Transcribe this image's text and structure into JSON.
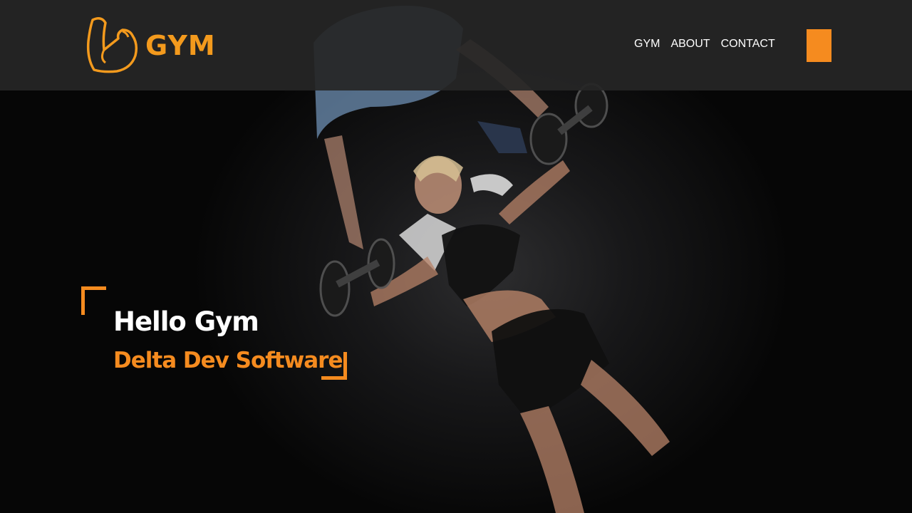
{
  "brand": {
    "logo_text": "GYM",
    "logo_icon": "flexed-arm-icon",
    "accent_color": "#f58b1f"
  },
  "nav": {
    "items": [
      {
        "label": "GYM"
      },
      {
        "label": "ABOUT"
      },
      {
        "label": "CONTACT"
      }
    ],
    "menu_button_icon": "menu-square-icon"
  },
  "hero": {
    "title": "Hello Gym",
    "subtitle": "Delta Dev Software",
    "background": "photo of a woman doing dumbbell bench press with a trainer spotting"
  }
}
